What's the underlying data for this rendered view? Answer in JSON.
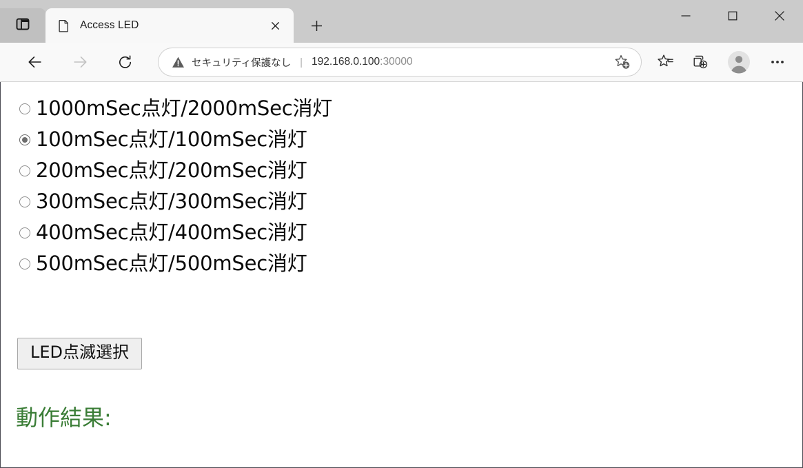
{
  "browser": {
    "tab_search_icon": "sidebar-panel-icon",
    "tabs": [
      {
        "title": "Access LED",
        "favicon": "document-icon",
        "close_label": "×",
        "active": true
      }
    ],
    "new_tab_label": "+",
    "window_controls": {
      "minimize": "—",
      "maximize": "□",
      "close": "✕"
    },
    "nav": {
      "back": "back-arrow-icon",
      "forward": "forward-arrow-icon",
      "reload": "reload-icon"
    },
    "omnibox": {
      "warning_icon": "warning-triangle-icon",
      "security_text": "セキュリティ保護なし",
      "separator": "|",
      "url_host": "192.168.0.100",
      "url_port": ":30000",
      "favorite_icon": "star-add-icon"
    },
    "toolbar_buttons": [
      {
        "name": "favorites",
        "icon": "favorites-star-list-icon"
      },
      {
        "name": "collections",
        "icon": "collections-icon"
      },
      {
        "name": "profile",
        "icon": "profile-avatar-icon"
      },
      {
        "name": "settings",
        "icon": "ellipsis-icon"
      }
    ]
  },
  "page": {
    "radio_group_name": "led-blink-pattern",
    "options": [
      {
        "label": "1000mSec点灯/2000mSec消灯",
        "checked": false
      },
      {
        "label": "100mSec点灯/100mSec消灯",
        "checked": true
      },
      {
        "label": "200mSec点灯/200mSec消灯",
        "checked": false
      },
      {
        "label": "300mSec点灯/300mSec消灯",
        "checked": false
      },
      {
        "label": "400mSec点灯/400mSec消灯",
        "checked": false
      },
      {
        "label": "500mSec点灯/500mSec消灯",
        "checked": false
      }
    ],
    "submit_label": "LED点滅選択",
    "result_label": "動作結果:",
    "result_color": "#3a7d36"
  }
}
